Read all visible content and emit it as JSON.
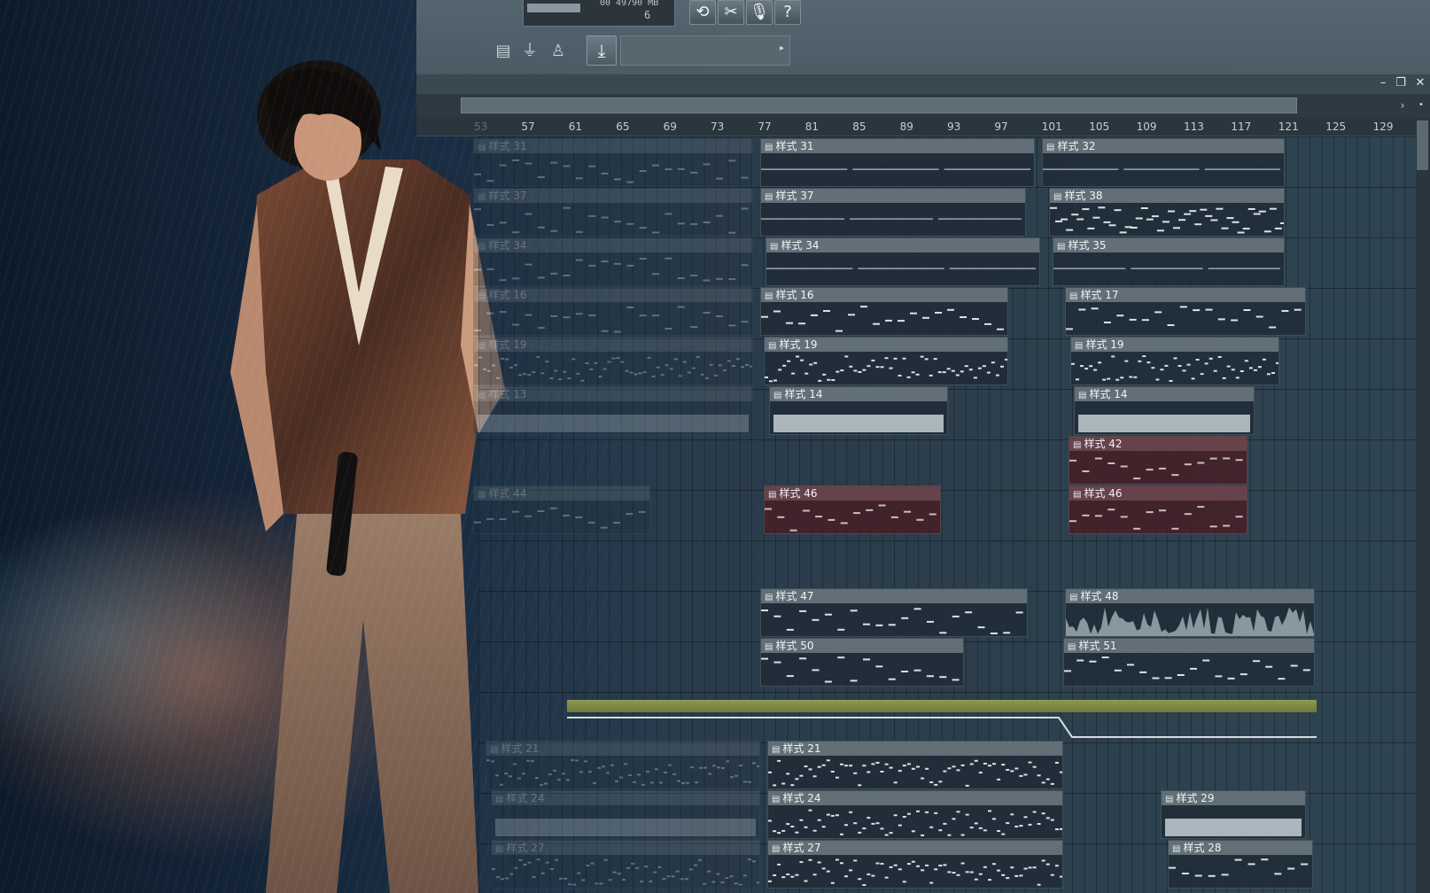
{
  "toolbar": {
    "memory_top": "00 49790 MB",
    "memory_bottom": "6",
    "buttons": [
      {
        "name": "loop-record-icon",
        "glyph": "⟲"
      },
      {
        "name": "snap-icon",
        "glyph": "✂"
      },
      {
        "name": "microphone-icon",
        "glyph": "🎙"
      },
      {
        "name": "help-icon",
        "glyph": "?"
      }
    ],
    "tools": [
      {
        "name": "page-icon",
        "glyph": "▤"
      },
      {
        "name": "plug-icon",
        "glyph": "⏚"
      },
      {
        "name": "figure-icon",
        "glyph": "♙"
      }
    ],
    "download_glyph": "⤓",
    "hint_arrow": "▸"
  },
  "window": {
    "minimize": "–",
    "restore": "❐",
    "close": "✕",
    "scroll_right": "›",
    "scroll_menu": "•"
  },
  "ruler": {
    "ticks": [
      "53",
      "57",
      "61",
      "65",
      "69",
      "73",
      "77",
      "81",
      "85",
      "89",
      "93",
      "97",
      "101",
      "105",
      "109",
      "113",
      "117",
      "121",
      "125",
      "129"
    ]
  },
  "clip_glyph": "▤",
  "clips": [
    {
      "label": "样式 31",
      "faded": true
    },
    {
      "label": "样式 31"
    },
    {
      "label": "样式 32"
    },
    {
      "label": "样式 37",
      "faded": true
    },
    {
      "label": "样式 37"
    },
    {
      "label": "样式 38"
    },
    {
      "label": "样式 34",
      "faded": true
    },
    {
      "label": "样式 34"
    },
    {
      "label": "样式 35"
    },
    {
      "label": "样式 16",
      "faded": true
    },
    {
      "label": "样式 16"
    },
    {
      "label": "样式 17"
    },
    {
      "label": "样式 19",
      "faded": true
    },
    {
      "label": "样式 19"
    },
    {
      "label": "样式 19"
    },
    {
      "label": "样式 13",
      "faded": true
    },
    {
      "label": "样式 14"
    },
    {
      "label": "样式 14"
    },
    {
      "label": "样式 42"
    },
    {
      "label": "样式 44",
      "faded": true
    },
    {
      "label": "样式 46"
    },
    {
      "label": "样式 46"
    },
    {
      "label": "样式 47"
    },
    {
      "label": "样式 48"
    },
    {
      "label": "样式 50"
    },
    {
      "label": "样式 51"
    },
    {
      "label": "样式 21",
      "faded": true
    },
    {
      "label": "样式 21"
    },
    {
      "label": "样式 24",
      "faded": true
    },
    {
      "label": "样式 24"
    },
    {
      "label": "样式 29"
    },
    {
      "label": "样式 27",
      "faded": true
    },
    {
      "label": "样式 27"
    },
    {
      "label": "样式 28"
    }
  ],
  "colors": {
    "toolbar": "#566770",
    "clip_header": "#78868c",
    "automation": "#8e9a52"
  }
}
